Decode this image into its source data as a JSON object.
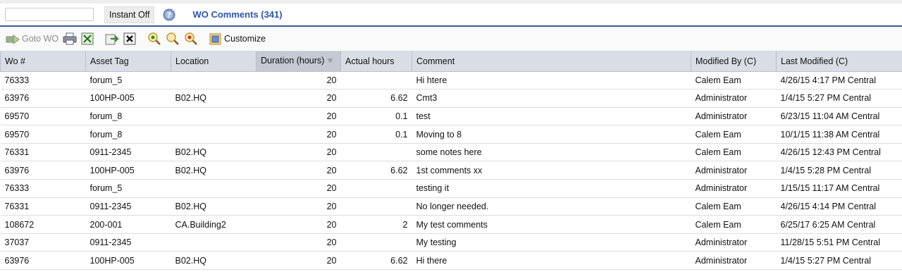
{
  "search": {
    "value": "",
    "placeholder": ""
  },
  "header": {
    "instant_label": "Instant Off",
    "help_icon": "help-circle-icon",
    "title": "WO Comments (341)"
  },
  "toolbar": {
    "goto_label": "Goto WO",
    "customize_label": "Customize",
    "icons": [
      "goto-wo-icon",
      "print-icon",
      "excel-export-icon",
      "export-icon",
      "delete-icon",
      "zoom-in-icon",
      "zoom-icon",
      "zoom-out-icon",
      "customize-icon"
    ]
  },
  "colors": {
    "title": "#2d56a6",
    "header_bg": "#d9dde5",
    "sorted_header_bg": "#c4c9d4",
    "rule": "#3d5a8f"
  },
  "grid": {
    "columns": [
      {
        "key": "wo",
        "label": "Wo #"
      },
      {
        "key": "asset",
        "label": "Asset Tag"
      },
      {
        "key": "location",
        "label": "Location"
      },
      {
        "key": "duration",
        "label": "Duration (hours)"
      },
      {
        "key": "actual",
        "label": "Actual hours"
      },
      {
        "key": "comment",
        "label": "Comment"
      },
      {
        "key": "modified_by",
        "label": "Modified By (C)"
      },
      {
        "key": "last_modified",
        "label": "Last Modified (C)"
      }
    ],
    "rows": [
      {
        "wo": "76333",
        "asset": "forum_5",
        "location": "",
        "duration": "20",
        "actual": "",
        "comment": "Hi htere",
        "modified_by": "Calem Eam",
        "last_modified": "4/26/15 4:17 PM Central"
      },
      {
        "wo": "63976",
        "asset": "100HP-005",
        "location": "B02.HQ",
        "duration": "20",
        "actual": "6.62",
        "comment": "Cmt3",
        "modified_by": "Administrator",
        "last_modified": "1/4/15 5:27 PM Central"
      },
      {
        "wo": "69570",
        "asset": "forum_8",
        "location": "",
        "duration": "20",
        "actual": "0.1",
        "comment": "test",
        "modified_by": "Administrator",
        "last_modified": "6/23/15 11:04 AM Central"
      },
      {
        "wo": "69570",
        "asset": "forum_8",
        "location": "",
        "duration": "20",
        "actual": "0.1",
        "comment": "Moving to 8",
        "modified_by": "Calem Eam",
        "last_modified": "10/1/15 11:38 AM Central"
      },
      {
        "wo": "76331",
        "asset": "0911-2345",
        "location": "B02.HQ",
        "duration": "20",
        "actual": "",
        "comment": "some notes here",
        "modified_by": "Calem Eam",
        "last_modified": "4/26/15 12:43 PM Central"
      },
      {
        "wo": "63976",
        "asset": "100HP-005",
        "location": "B02.HQ",
        "duration": "20",
        "actual": "6.62",
        "comment": "1st comments xx",
        "modified_by": "Administrator",
        "last_modified": "1/4/15 5:28 PM Central"
      },
      {
        "wo": "76333",
        "asset": "forum_5",
        "location": "",
        "duration": "20",
        "actual": "",
        "comment": "testing it",
        "modified_by": "Administrator",
        "last_modified": "1/15/15 11:17 AM Central"
      },
      {
        "wo": "76331",
        "asset": "0911-2345",
        "location": "B02.HQ",
        "duration": "20",
        "actual": "",
        "comment": "No longer needed.",
        "modified_by": "Calem Eam",
        "last_modified": "4/26/15 4:14 PM Central"
      },
      {
        "wo": "108672",
        "asset": "200-001",
        "location": "CA.Building2",
        "duration": "20",
        "actual": "2",
        "comment": "My test comments",
        "modified_by": "Calem Eam",
        "last_modified": "6/25/17 6:25 AM Central"
      },
      {
        "wo": "37037",
        "asset": "0911-2345",
        "location": "",
        "duration": "20",
        "actual": "",
        "comment": "My testing",
        "modified_by": "Administrator",
        "last_modified": "11/28/15 5:51 PM Central"
      },
      {
        "wo": "63976",
        "asset": "100HP-005",
        "location": "B02.HQ",
        "duration": "20",
        "actual": "6.62",
        "comment": "Hi there",
        "modified_by": "Administrator",
        "last_modified": "1/4/15 5:27 PM Central"
      }
    ]
  }
}
